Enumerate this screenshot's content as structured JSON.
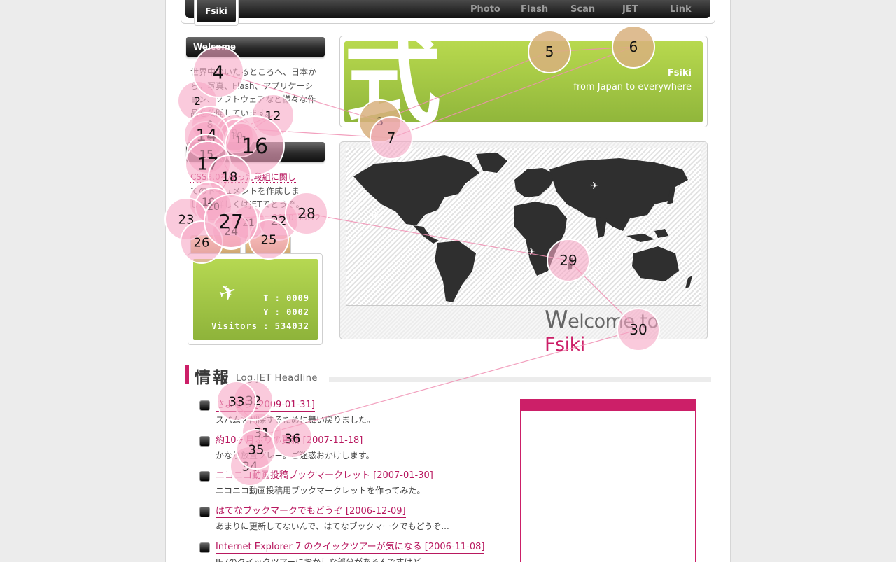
{
  "header": {
    "logo": "Fsiki",
    "nav": [
      "Photo",
      "Flash",
      "Scan",
      "JET",
      "Link"
    ]
  },
  "sidebar": {
    "welcome_title": "Welcome",
    "welcome_text": "世界中のいたるところへ、日本から。写真、Flash、アプリケーション、ソフトウェアなど様々な作品を公開しています。",
    "log_link1": "CSS3.0を使った段組に関し",
    "log_text_mid": "てのドキュメントを作成しま",
    "log_link2": "メント",
    "log_text_end": "した。詳しくはJETでどうぞ。",
    "log_date": "2010.03.12",
    "counter": {
      "icon": "airplane-icon",
      "today": "T : 0009",
      "yesterday": "Y : 0002",
      "visitors": "Visitors : 534032"
    }
  },
  "hero": {
    "kanji": "式",
    "title": "Fsiki",
    "subtitle": "from Japan to everywhere"
  },
  "map": {
    "caption_w": "W",
    "caption_mid": "elcome to ",
    "caption_brand": "Fsiki"
  },
  "news": {
    "heading": "情報",
    "subheading": "Log.JET Headline",
    "items": [
      {
        "title": "さよなら [2009-01-31]",
        "desc": "スパムを削除するために舞い戻りました。"
      },
      {
        "title": "約10ヶ月ぶりの更新 [2007-11-18]",
        "desc": "かなり放置プレー。ご迷惑おかけします。"
      },
      {
        "title": "ニコニコ動画投稿ブックマークレット [2007-01-30]",
        "desc": "ニコニコ動画投稿用ブックマークレットを作ってみた。"
      },
      {
        "title": "はてなブックマークでもどうぞ [2006-12-09]",
        "desc": "あまりに更新してないんで、はてなブックマークでもどうぞ..."
      },
      {
        "title": "Internet Explorer 7 のクイックツアーが気になる [2006-11-08]",
        "desc": "IE7のクイックツアーにおかしな部分があるんですけど。"
      }
    ]
  },
  "overlay": {
    "colors": {
      "pink": "#f6a6c4",
      "tan": "#d8b07e",
      "line": "#f08fb3"
    },
    "markers": [
      "2",
      "3",
      "4",
      "5",
      "6",
      "7",
      "8",
      "9",
      "10",
      "11",
      "12",
      "13",
      "14",
      "15",
      "16",
      "17",
      "18",
      "19",
      "20",
      "21",
      "22",
      "23",
      "24",
      "25",
      "26",
      "27",
      "28",
      "29",
      "30",
      "31",
      "32",
      "33",
      "34",
      "35",
      "36"
    ]
  }
}
